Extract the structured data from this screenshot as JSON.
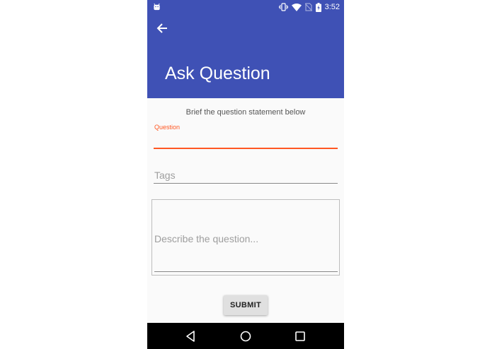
{
  "status_bar": {
    "time": "3:52",
    "icons": [
      "android-notification-icon",
      "vibrate-icon",
      "wifi-icon",
      "no-sim-icon",
      "battery-charging-icon"
    ]
  },
  "app_bar": {
    "back_icon": "arrow-back-icon",
    "title": "Ask Question",
    "color": "#3f51b5"
  },
  "form": {
    "hint": "Brief the question statement below",
    "question_label": "Question",
    "question_value": "",
    "tags_placeholder": "Tags",
    "tags_value": "",
    "description_placeholder": "Describe the question...",
    "description_value": "",
    "submit_label": "SUBMIT",
    "accent_color": "#ff5722"
  },
  "nav_bar": {
    "buttons": [
      "back-triangle-icon",
      "home-circle-icon",
      "recents-square-icon"
    ]
  }
}
